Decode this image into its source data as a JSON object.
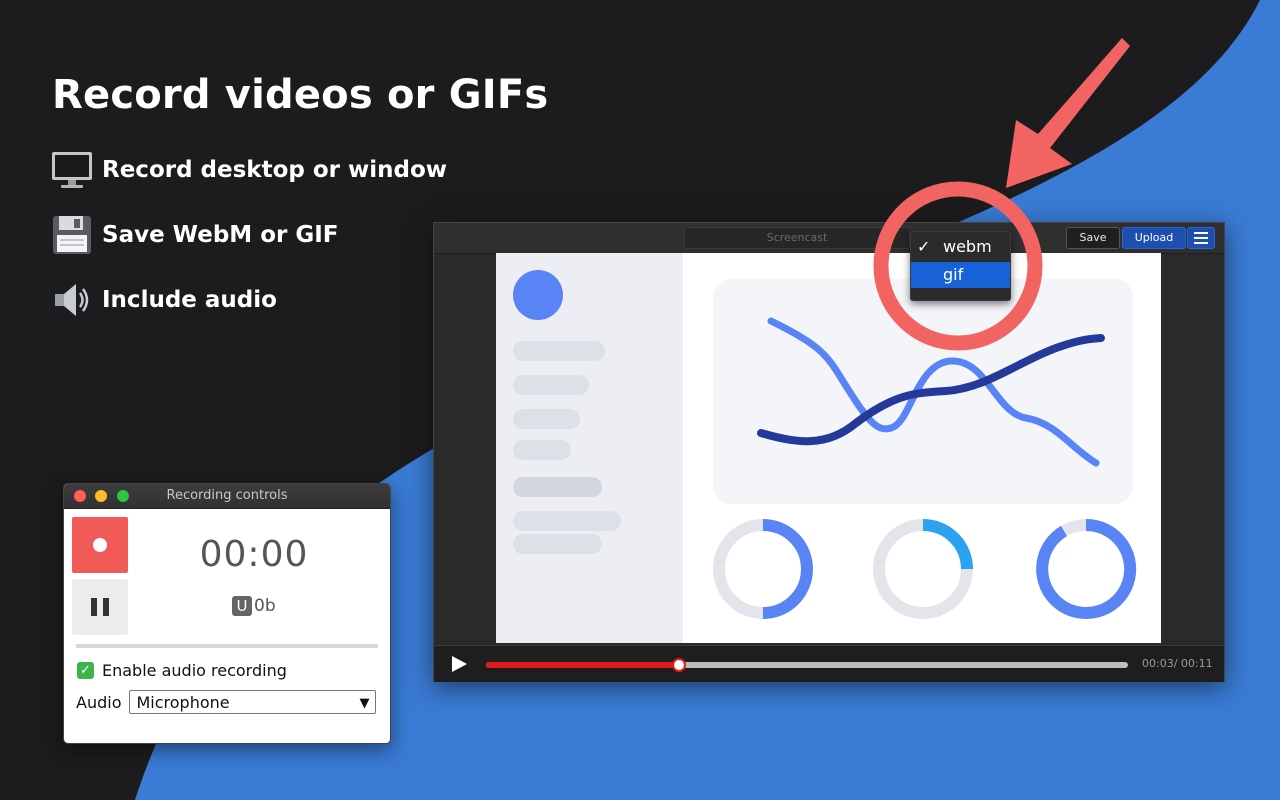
{
  "headline": "Record videos or GIFs",
  "features": [
    {
      "icon": "monitor-icon",
      "label": "Record desktop or window"
    },
    {
      "icon": "floppy-disk-icon",
      "label": "Save WebM or GIF"
    },
    {
      "icon": "speaker-icon",
      "label": "Include audio"
    }
  ],
  "colors": {
    "background_dark": "#1c1c1e",
    "background_blue": "#3a7bd5",
    "highlight_ring": "#f26461",
    "accent_blue": "#1d4fb0",
    "record_red": "#f05a57",
    "progress_red": "#e01b1b"
  },
  "player": {
    "title_placeholder": "Screencast",
    "save_label": "Save",
    "upload_label": "Upload",
    "menu_icon": "hamburger-menu-icon",
    "play_icon": "play-icon",
    "progress_fraction": 0.3,
    "time_readout": "00:03/ 00:11",
    "format_menu": {
      "options": [
        "webm",
        "gif"
      ],
      "checked": "webm",
      "highlighted": "gif",
      "check_mark": "✓"
    }
  },
  "recording_controls": {
    "title": "Recording controls",
    "record_icon": "record-icon",
    "pause_icon": "pause-icon",
    "timer": "00:00",
    "size_prefix": "U",
    "size_value": "0b",
    "audio_checkbox_label": "Enable audio recording",
    "audio_checkbox_checked": true,
    "audio_label": "Audio",
    "audio_source": "Microphone"
  }
}
